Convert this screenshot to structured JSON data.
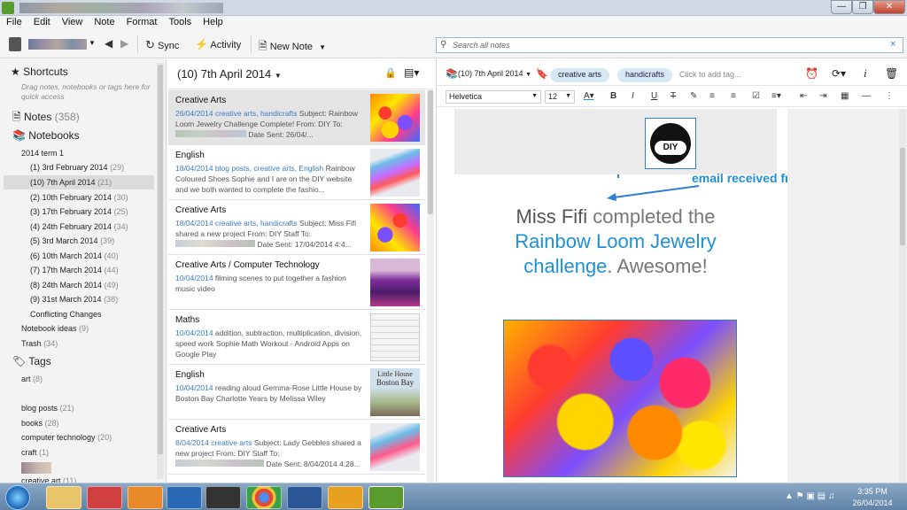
{
  "menu": [
    "File",
    "Edit",
    "View",
    "Note",
    "Format",
    "Tools",
    "Help"
  ],
  "toolbar": {
    "sync": "Sync",
    "activity": "Activity",
    "new_note": "New Note"
  },
  "search": {
    "placeholder": "Search all notes"
  },
  "sidebar": {
    "shortcuts": "Shortcuts",
    "shortcuts_hint": "Drag notes, notebooks or tags here for quick access",
    "notes": "Notes",
    "notes_count": "(358)",
    "notebooks": "Notebooks",
    "group": "2014 term 1",
    "notebook_items": [
      {
        "label": "(1) 3rd February 2014",
        "count": "(29)"
      },
      {
        "label": "(10) 7th April 2014",
        "count": "(21)"
      },
      {
        "label": "(2) 10th February 2014",
        "count": "(30)"
      },
      {
        "label": "(3) 17th February 2014",
        "count": "(25)"
      },
      {
        "label": "(4) 24th February 2014",
        "count": "(34)"
      },
      {
        "label": "(5) 3rd March 2014",
        "count": "(39)"
      },
      {
        "label": "(6) 10th March 2014",
        "count": "(40)"
      },
      {
        "label": "(7) 17th March 2014",
        "count": "(44)"
      },
      {
        "label": "(8) 24th March 2014",
        "count": "(49)"
      },
      {
        "label": "(9) 31st March 2014",
        "count": "(38)"
      }
    ],
    "conflicting": "Conflicting Changes",
    "notebook_ideas": "Notebook ideas",
    "notebook_ideas_count": "(9)",
    "trash": "Trash",
    "trash_count": "(34)",
    "tags": "Tags",
    "tag_items": [
      {
        "label": "art",
        "count": "(8)"
      },
      {
        "label": "blog posts",
        "count": "(21)"
      },
      {
        "label": "books",
        "count": "(28)"
      },
      {
        "label": "computer technology",
        "count": "(20)"
      },
      {
        "label": "craft",
        "count": "(1)"
      },
      {
        "label": "creative art",
        "count": "(11)"
      }
    ]
  },
  "notelist": {
    "title": "(10) 7th April 2014",
    "notes": [
      {
        "title": "Creative Arts",
        "date": "26/04/2014",
        "tags": "creative arts, handicrafts",
        "snippet": " Subject: Rainbow Loom Jewelry Challenge Complete! From: DIY To:",
        "tail": "Date Sent: 26/04/..."
      },
      {
        "title": "English",
        "date": "18/04/2014",
        "tags": "blog posts, creative arts, English",
        "snippet": " Rainbow Coloured Shoes Sophie and I are on the DIY website and we both wanted to complete the fashio...",
        "tail": ""
      },
      {
        "title": "Creative Arts",
        "date": "18/04/2014",
        "tags": "creative arts, handicrafts",
        "snippet": " Subject: Miss Fifi shared a new project From: DIY Staff To:",
        "tail": "Date Sent: 17/04/2014 4:4..."
      },
      {
        "title": "Creative Arts / Computer Technology",
        "date": "10/04/2014",
        "tags": "",
        "snippet": " filming scenes to put together a fashion music video",
        "tail": ""
      },
      {
        "title": "Maths",
        "date": "10/04/2014",
        "tags": "",
        "snippet": " addition, subtraction, multiplication, division, speed work Sophie Math Workout - Android Apps on Google Play",
        "tail": ""
      },
      {
        "title": "English",
        "date": "10/04/2014",
        "tags": "",
        "snippet": " reading aloud Gemma-Rose Little House by Boston Bay Charlotte Years by Melissa Wiley",
        "tail": ""
      },
      {
        "title": "Creative Arts",
        "date": "8/04/2014",
        "tags": "creative arts",
        "snippet": " Subject: Lady Gebbles shared a new project From: DIY Staff To:",
        "tail": "Date Sent: 8/04/2014 4:28..."
      }
    ]
  },
  "editor": {
    "notebook": "(10) 7th April 2014",
    "tags": [
      "creative arts",
      "handicrafts"
    ],
    "tag_placeholder": "Click to add tag...",
    "font": "Helvetica",
    "size": "12",
    "logo_text": "DIY",
    "annotation": "email received from DIY",
    "heading_1": "Miss Fifi",
    "heading_2": " completed the",
    "heading_3": "Rainbow Loom Jewelry",
    "heading_4": "challenge",
    "heading_5": ". Awesome!"
  },
  "book_thumb": {
    "line1": "Little House",
    "line2": "Boston Bay"
  },
  "clock": {
    "time": "3:35 PM",
    "date": "26/04/2014"
  },
  "colors": {
    "link": "#3a7cc6",
    "accent": "#1e90d8",
    "selected": "#dcdcdc"
  }
}
